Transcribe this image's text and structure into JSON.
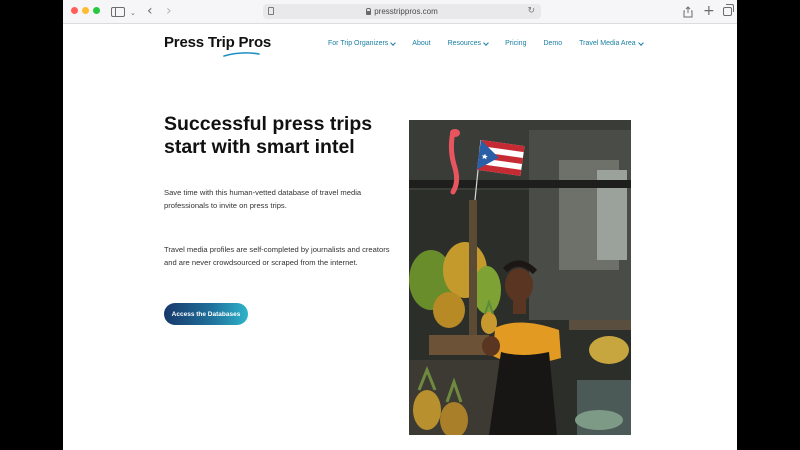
{
  "browser": {
    "url": "presstrippros.com"
  },
  "site": {
    "logo": "Press Trip Pros",
    "nav": [
      {
        "label": "For Trip Organizers",
        "has_dropdown": true
      },
      {
        "label": "About",
        "has_dropdown": false
      },
      {
        "label": "Resources",
        "has_dropdown": true
      },
      {
        "label": "Pricing",
        "has_dropdown": false
      },
      {
        "label": "Demo",
        "has_dropdown": false
      },
      {
        "label": "Travel Media Area",
        "has_dropdown": true
      }
    ]
  },
  "hero": {
    "headline": "Successful press trips start with smart intel",
    "paragraph_1": "Save time with this human-vetted database of travel media professionals to invite on press trips.",
    "paragraph_2": "Travel media profiles are self-completed by journalists and creators and are never crowdsourced or scraped from the internet.",
    "cta_label": "Access the Databases"
  },
  "colors": {
    "nav_link": "#1a7fa3",
    "cta_start": "#17386c",
    "cta_end": "#2fb3c9",
    "logo_accent": "#1f8fc0"
  },
  "icons": [
    "page-icon",
    "lock-icon",
    "reload-icon",
    "share-icon",
    "plus-icon",
    "tabs-icon",
    "sidebar-icon",
    "back-icon",
    "forward-icon",
    "chevron-down-icon"
  ]
}
